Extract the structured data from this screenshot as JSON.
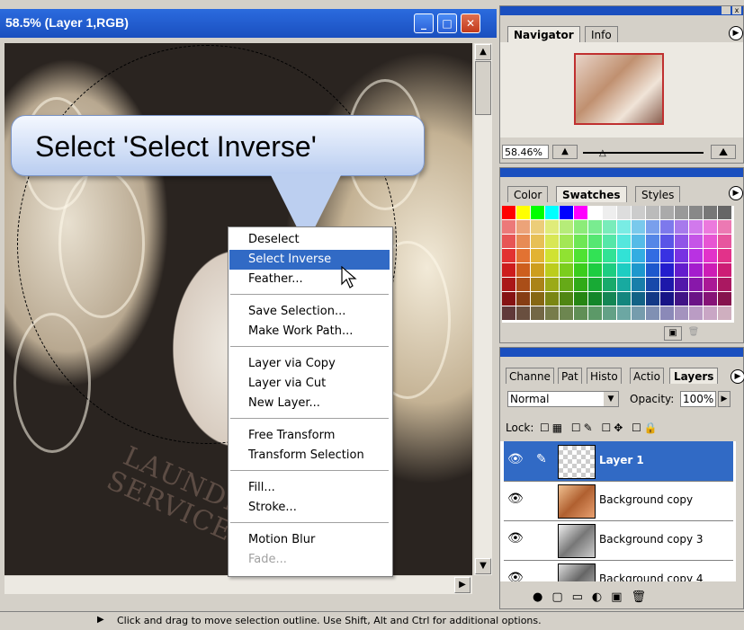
{
  "document": {
    "title": "58.5% (Layer 1,RGB)",
    "controls": {
      "minimize": "_",
      "maximize": "□",
      "close": "✕"
    },
    "tattoo_text": [
      "LAUNDRY",
      "SERVICE"
    ]
  },
  "callout": {
    "text": "Select 'Select Inverse'"
  },
  "context_menu": {
    "items": [
      {
        "label": "Deselect"
      },
      {
        "label": "Select Inverse",
        "state": "highlighted"
      },
      {
        "label": "Feather..."
      },
      {
        "label": "Save Selection..."
      },
      {
        "label": "Make Work Path..."
      },
      {
        "label": "Layer via Copy"
      },
      {
        "label": "Layer via Cut"
      },
      {
        "label": "New Layer..."
      },
      {
        "label": "Free Transform"
      },
      {
        "label": "Transform Selection"
      },
      {
        "label": "Fill..."
      },
      {
        "label": "Stroke..."
      },
      {
        "label": "Motion Blur"
      },
      {
        "label": "Fade...",
        "state": "disabled"
      }
    ]
  },
  "navigator": {
    "tabs": [
      "Navigator",
      "Info"
    ],
    "zoom_value": "58.46%"
  },
  "swatches": {
    "tabs": [
      "Color",
      "Swatches",
      "Styles"
    ]
  },
  "layers_panel": {
    "tabs": [
      "Channe",
      "Pat",
      "Histo",
      "Actio",
      "Layers"
    ],
    "blend_mode": "Normal",
    "opacity_label": "Opacity:",
    "opacity_value": "100%",
    "lock_label": "Lock:",
    "layers": [
      {
        "name": "Layer 1",
        "selected": true
      },
      {
        "name": "Background copy",
        "selected": false
      },
      {
        "name": "Background copy 3",
        "selected": false
      },
      {
        "name": "Background copy 4",
        "selected": false
      }
    ]
  },
  "status": {
    "text": "Click and drag to move selection outline.  Use Shift, Alt and Ctrl for additional options."
  },
  "colors": {
    "title_blue": "#1a4fbf",
    "highlight": "#316ac5",
    "panel_gray": "#d4d0c8"
  }
}
